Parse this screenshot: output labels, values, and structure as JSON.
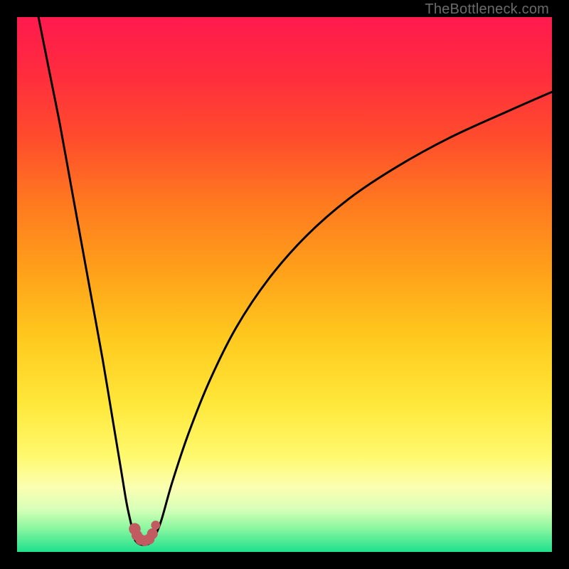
{
  "attribution": "TheBottleneck.com",
  "colors": {
    "frame": "#000000",
    "attribution_text": "#6b6b6b",
    "curve": "#000000",
    "dot": "#c25a62",
    "gradient_stops": [
      {
        "offset": 0.0,
        "color": "#ff1a4e"
      },
      {
        "offset": 0.1,
        "color": "#ff2b3f"
      },
      {
        "offset": 0.22,
        "color": "#ff4a2d"
      },
      {
        "offset": 0.35,
        "color": "#ff7a1f"
      },
      {
        "offset": 0.48,
        "color": "#ffa21a"
      },
      {
        "offset": 0.6,
        "color": "#ffc91e"
      },
      {
        "offset": 0.72,
        "color": "#ffe739"
      },
      {
        "offset": 0.82,
        "color": "#fff96d"
      },
      {
        "offset": 0.88,
        "color": "#fbffb2"
      },
      {
        "offset": 0.92,
        "color": "#d8ffb8"
      },
      {
        "offset": 0.955,
        "color": "#8cf7a0"
      },
      {
        "offset": 1.0,
        "color": "#1fe08c"
      }
    ]
  },
  "chart_data": {
    "type": "line",
    "title": "",
    "xlabel": "",
    "ylabel": "",
    "x_range": [
      0,
      100
    ],
    "y_range": [
      0,
      100
    ],
    "series": [
      {
        "name": "left-branch",
        "x": [
          4,
          6,
          8,
          10,
          12,
          14,
          16,
          18,
          19.5,
          20.5,
          21.5,
          22.0,
          22.3
        ],
        "y": [
          100,
          90,
          80,
          69,
          58,
          47,
          36,
          24,
          15,
          9,
          4.5,
          2.8,
          2.3
        ]
      },
      {
        "name": "right-branch",
        "x": [
          25.2,
          25.8,
          27,
          29,
          32,
          36,
          41,
          47,
          54,
          62,
          71,
          81,
          92,
          100
        ],
        "y": [
          2.3,
          3.0,
          6,
          13,
          22,
          32,
          42,
          51,
          59,
          66,
          72,
          77.5,
          82.5,
          86
        ]
      },
      {
        "name": "valley-floor",
        "x": [
          22.3,
          22.8,
          23.4,
          24.0,
          24.6,
          25.2
        ],
        "y": [
          2.3,
          1.8,
          1.6,
          1.6,
          1.8,
          2.3
        ]
      }
    ],
    "markers": [
      {
        "name": "valley-dot-left-top",
        "x": 22.0,
        "y": 4.3,
        "r": 1.1
      },
      {
        "name": "valley-dot-left-mid",
        "x": 22.4,
        "y": 3.1,
        "r": 1.0
      },
      {
        "name": "valley-dot-left-low",
        "x": 23.1,
        "y": 2.3,
        "r": 1.0
      },
      {
        "name": "valley-dot-center",
        "x": 23.9,
        "y": 2.1,
        "r": 1.0
      },
      {
        "name": "valley-dot-right-low",
        "x": 24.7,
        "y": 2.4,
        "r": 1.0
      },
      {
        "name": "valley-dot-right-mid",
        "x": 25.3,
        "y": 3.4,
        "r": 1.0
      },
      {
        "name": "valley-dot-right-top",
        "x": 25.9,
        "y": 5.0,
        "r": 0.85
      }
    ]
  }
}
